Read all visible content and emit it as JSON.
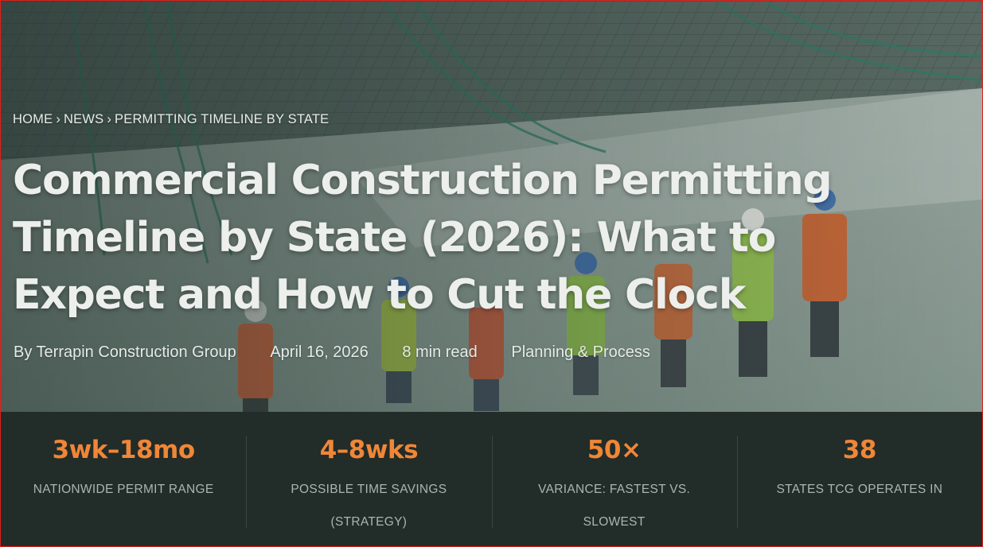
{
  "breadcrumb": {
    "home": "HOME",
    "news": "NEWS",
    "current": "PERMITTING TIMELINE BY STATE",
    "separator": "›"
  },
  "article": {
    "title": "Commercial Construction Permitting Timeline by State (2026): What to Expect and How to Cut the Clock",
    "author": "By Terrapin Construction Group",
    "date": "April 16, 2026",
    "read_time": "8 min read",
    "category": "Planning & Process"
  },
  "stats": [
    {
      "value": "3wk–18mo",
      "label": "NATIONWIDE PERMIT RANGE"
    },
    {
      "value": "4–8wks",
      "label": "POSSIBLE TIME SAVINGS (STRATEGY)"
    },
    {
      "value": "50×",
      "label": "VARIANCE: FASTEST VS. SLOWEST"
    },
    {
      "value": "38",
      "label": "STATES TCG OPERATES IN"
    }
  ],
  "colors": {
    "accent": "#f08637",
    "stats_bg": "#222c28",
    "hero_overlay": "#30564e"
  }
}
